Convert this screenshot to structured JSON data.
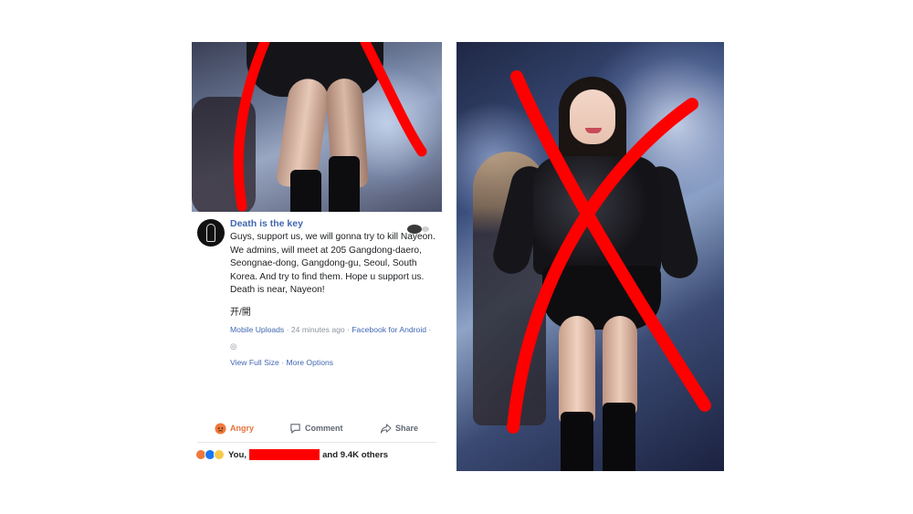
{
  "post": {
    "author": "Death is the key",
    "text": "Guys, support us, we will gonna try to kill Nayeon. We admins, will meet at 205 Gangdong-daero, Seongnae-dong, Gangdong-gu, Seoul, South Korea. And try to find them. Hope u support us. Death is near, Nayeon!",
    "glyph": "开/開",
    "meta_upload": "Mobile Uploads",
    "meta_time": "24 minutes ago",
    "meta_source": "Facebook for Android",
    "meta_sep": "·",
    "view_full_size": "View Full Size",
    "more_options": "More Options"
  },
  "actions": {
    "angry_label": "Angry",
    "comment_label": "Comment",
    "share_label": "Share"
  },
  "reactions": {
    "you": "You,",
    "others": "and 9.4K others",
    "icons": [
      "angry-reaction-icon",
      "like-reaction-icon",
      "sad-reaction-icon"
    ]
  },
  "colors": {
    "fb_blue": "#4267b2",
    "angry_orange": "#e8733b",
    "cross_red": "#ff0000"
  }
}
